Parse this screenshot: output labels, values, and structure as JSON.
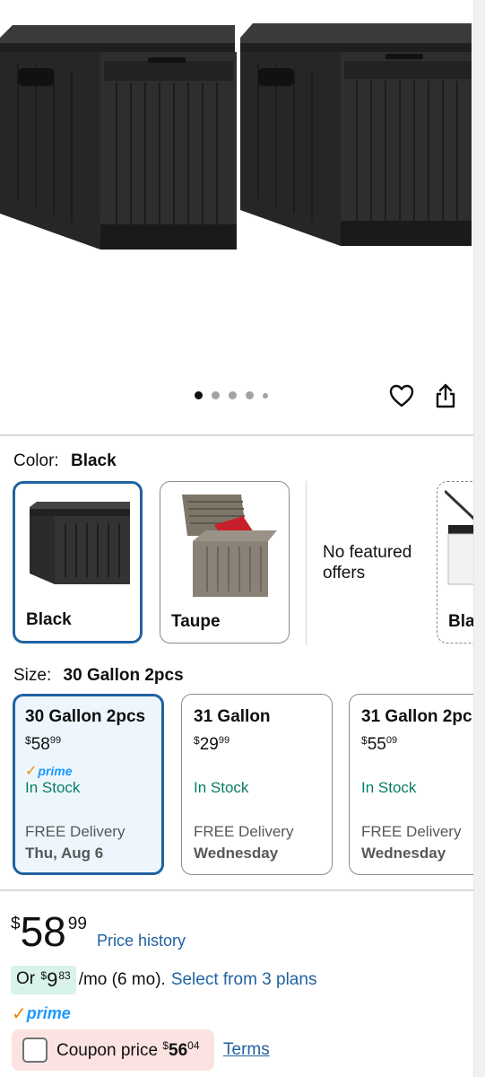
{
  "hero": {
    "dot_count": 5,
    "active_dot": 0,
    "product_color": "#2b2b2b"
  },
  "color": {
    "label": "Color:",
    "selected": "Black",
    "options": [
      {
        "name": "Black",
        "selected": true
      },
      {
        "name": "Taupe",
        "selected": false
      },
      {
        "name": "Bla",
        "selected": false
      }
    ],
    "no_featured": "No featured offers"
  },
  "size": {
    "label": "Size:",
    "selected": "30 Gallon 2pcs",
    "options": [
      {
        "title": "30 Gallon 2pcs",
        "currency": "$",
        "price_whole": "58",
        "price_frac": "99",
        "prime": "prime",
        "stock": "In Stock",
        "delivery": "FREE Delivery",
        "delivery_date": "Thu, Aug 6"
      },
      {
        "title": "31 Gallon",
        "currency": "$",
        "price_whole": "29",
        "price_frac": "99",
        "stock": "In Stock",
        "delivery": "FREE Delivery",
        "delivery_date": "Wednesday"
      },
      {
        "title": "31 Gallon 2pc",
        "currency": "$",
        "price_whole": "55",
        "price_frac": "09",
        "stock": "In Stock",
        "delivery": "FREE Delivery",
        "delivery_date": "Wednesday"
      }
    ]
  },
  "price": {
    "currency": "$",
    "whole": "58",
    "frac": "99",
    "history_link": "Price history"
  },
  "plan": {
    "or": "Or",
    "currency": "$",
    "amount": "9",
    "cents": "83",
    "per": "/mo (6 mo).",
    "link": "Select from 3 plans"
  },
  "prime_label": "prime",
  "coupon": {
    "text": "Coupon price",
    "currency": "$",
    "whole": "56",
    "frac": "04",
    "terms": "Terms"
  },
  "colors": {
    "link": "#2162a1",
    "selected_border": "#2162a1",
    "stock_green": "#067d62",
    "prime_blue": "#1a98ff",
    "coupon_bg": "#fde2e2",
    "plan_bg": "#d8f3e8"
  }
}
